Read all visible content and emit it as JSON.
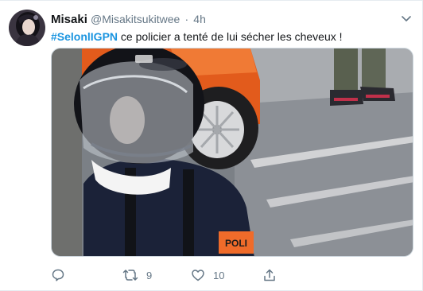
{
  "tweet": {
    "author_name": "Misaki",
    "author_handle": "@Misakitsukitwee",
    "separator": "·",
    "time": "4h",
    "hashtag": "#SelonlIGPN",
    "text": " ce policier a tenté de lui sécher les cheveux !",
    "media": {
      "armband_text": "POLI"
    },
    "actions": {
      "reply_count": "",
      "retweet_count": "9",
      "like_count": "10",
      "share_count": ""
    }
  },
  "colors": {
    "link": "#1b95e0",
    "muted": "#657786",
    "text": "#14171a",
    "border": "#e6ecf0"
  },
  "icons": [
    "avatar",
    "chevron-down-icon",
    "reply-icon",
    "retweet-icon",
    "like-icon",
    "share-icon"
  ]
}
